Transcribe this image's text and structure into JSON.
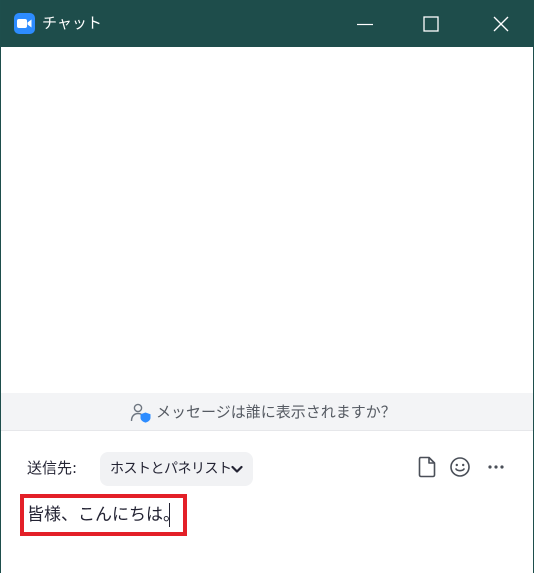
{
  "window": {
    "title": "チャット",
    "app_icon": "zoom-camera-icon",
    "controls": [
      "minimize-icon",
      "maximize-icon",
      "close-icon"
    ]
  },
  "visibility": {
    "text": "メッセージは誰に表示されますか？",
    "icon": "user-shield-icon"
  },
  "compose": {
    "to_label": "送信先:",
    "recipient": "ホストとパネリスト",
    "recipient_icon": "chevron-down-icon",
    "tools": [
      "file-icon",
      "emoji-icon",
      "more-icon"
    ],
    "message": "皆様、こんにちは。"
  },
  "colors": {
    "titlebar": "#1e4d4b",
    "accent": "#2d8cff",
    "highlight_border": "#e32028"
  }
}
